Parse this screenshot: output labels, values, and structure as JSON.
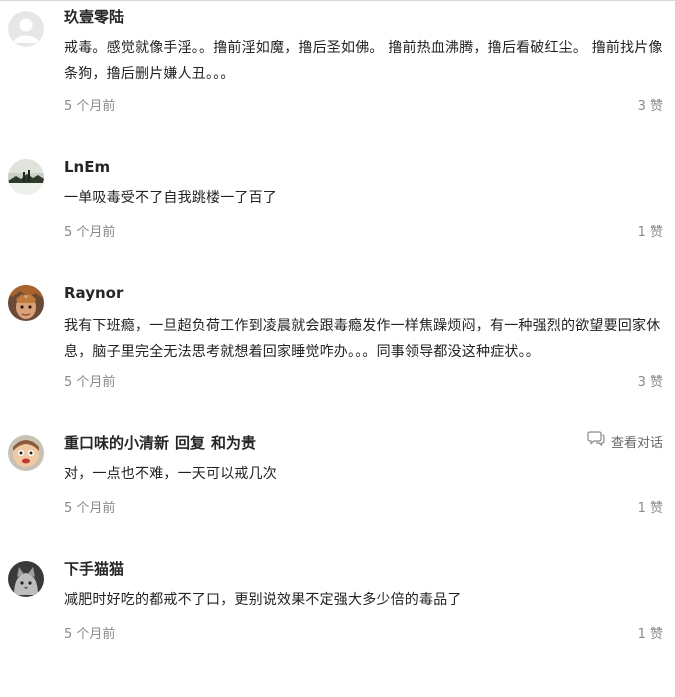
{
  "comments": [
    {
      "author": "玖壹零陆",
      "text": "戒毒。感觉就像手淫。。撸前淫如魔，撸后圣如佛。 撸前热血沸腾，撸后看破红尘。 撸前找片像条狗，撸后删片嫌人丑。。。",
      "time": "5 个月前",
      "likes": "3 赞",
      "avatar_icon": "default-user-avatar"
    },
    {
      "author": "LnEm",
      "text": "一单吸毒受不了自我跳楼一了百了",
      "time": "5 个月前",
      "likes": "1 赞",
      "avatar_icon": "landscape-photo-avatar"
    },
    {
      "author": "Raynor",
      "text": "我有下班瘾，一旦超负荷工作到凌晨就会跟毒瘾发作一样焦躁烦闷，有一种强烈的欲望要回家休息，脑子里完全无法思考就想着回家睡觉咋办。。。同事领导都没这种症状。。",
      "time": "5 个月前",
      "likes": "3 赞",
      "avatar_icon": "character-portrait-avatar"
    },
    {
      "author": "重口味的小清新",
      "reply_word": "回复",
      "reply_to": "和为贵",
      "view_conversation": "查看对话",
      "text": "对，一点也不难，一天可以戒几次",
      "time": "5 个月前",
      "likes": "1 赞",
      "avatar_icon": "cartoon-face-avatar"
    },
    {
      "author": "下手猫猫",
      "text": "减肥时好吃的都戒不了口，更别说效果不定强大多少倍的毒品了",
      "time": "5 个月前",
      "likes": "1 赞",
      "avatar_icon": "cat-photo-avatar"
    }
  ],
  "colors": {
    "author": "#262626",
    "body": "#222222",
    "meta": "#8a8a8a",
    "divider": "#d8d8d8"
  }
}
